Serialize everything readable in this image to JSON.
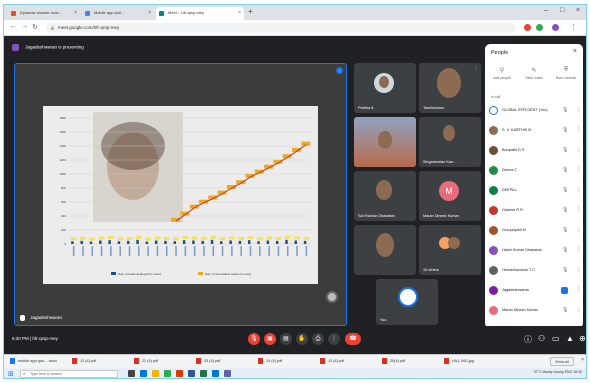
{
  "browser": {
    "tabs": [
      {
        "label": "Dynamic shower rods…",
        "color": "#e44d26"
      },
      {
        "label": "Mobile app poll…",
        "color": "#4285f4"
      },
      {
        "label": "Meet – hfr-qrsp-mey",
        "color": "#00897b"
      }
    ],
    "url": "meet.google.com/hfr-qrsp-mey"
  },
  "meet": {
    "presenting": "Jagadeshwaran is presenting",
    "presenter_name": "Jagadeshwaran",
    "time_code": "6:30 PM | hfr-qrsp-mey",
    "tiles": [
      {
        "name": "Prabha A"
      },
      {
        "name": "Tamilselvam"
      },
      {
        "name": ""
      },
      {
        "name": "Singaravelan Kan…"
      },
      {
        "name": "Sai Eshwar Dhanabal"
      },
      {
        "name": "Maran Dinesh Kumar",
        "letter": "M"
      },
      {
        "name": ""
      },
      {
        "name": "10 others"
      },
      {
        "name": "You"
      }
    ]
  },
  "chart": {
    "ytick_labels": [
      "1800",
      "1600",
      "1400",
      "1200",
      "1000",
      "800",
      "600",
      "400",
      "200",
      "0"
    ],
    "legend": [
      "Sum of funds deployed (in Lacs)",
      "Sum of Cumulative funds (in Lacs)"
    ]
  },
  "chart_data": {
    "type": "bar",
    "ylim": [
      0,
      1800
    ],
    "series": [
      {
        "name": "Sum of funds deployed (in Lacs)",
        "color": "#1f4e9b",
        "values": [
          40,
          45,
          35,
          50,
          55,
          40,
          45,
          60,
          35,
          50,
          45,
          40,
          55,
          50,
          45,
          60,
          40,
          50,
          45,
          55,
          40,
          50,
          45,
          60,
          50,
          45
        ]
      },
      {
        "name": "Sum of Cumulative funds (in Lacs)",
        "color": "#f0a820",
        "values": [
          0,
          0,
          0,
          0,
          0,
          0,
          0,
          0,
          0,
          0,
          0,
          330,
          420,
          520,
          590,
          650,
          720,
          800,
          870,
          960,
          1020,
          1090,
          1160,
          1240,
          1330,
          1420
        ]
      }
    ]
  },
  "people": {
    "title": "People",
    "actions": [
      "Add people",
      "Take notes",
      "Host controls"
    ],
    "in_call_label": "In call",
    "participants": [
      {
        "name": "GLOBAL EFFICIENT (You)",
        "color": "#fff",
        "cam": false
      },
      {
        "name": "S. V. KARTHIK B",
        "color": "#8d6a52",
        "cam": false
      },
      {
        "name": "Boopathi D S",
        "color": "#6b4f3a",
        "cam": false
      },
      {
        "name": "Deena C",
        "color": "#1e8e3e",
        "cam": false
      },
      {
        "name": "DEEPA L",
        "color": "#0b8043",
        "cam": false
      },
      {
        "name": "Ganesh R R",
        "color": "#c0392b",
        "cam": false
      },
      {
        "name": "Gurupriyadi M",
        "color": "#a0522d",
        "cam": false
      },
      {
        "name": "Harini Kumar Dhanabal",
        "color": "#8a4fbf",
        "cam": false
      },
      {
        "name": "Hemachandran T C",
        "color": "#5f6368",
        "cam": false
      },
      {
        "name": "Jagadeshwaran",
        "color": "#7b1fa2",
        "cam": true
      },
      {
        "name": "Maran Dinesh Kumar",
        "color": "#e96a7b",
        "cam": false
      }
    ]
  },
  "downloads": [
    {
      "label": "mobile app quo….docx",
      "kind": "doc"
    },
    {
      "label": "12 (4).pdf",
      "kind": "pdf"
    },
    {
      "label": "22 (4).pdf",
      "kind": "pdf"
    },
    {
      "label": "33 (4).pdf",
      "kind": "pdf"
    },
    {
      "label": "14 (4).pdf",
      "kind": "pdf"
    },
    {
      "label": "12 (4).pdf",
      "kind": "pdf"
    },
    {
      "label": "20(4).pdf",
      "kind": "pdf"
    },
    {
      "label": "HILL ING.jpg",
      "kind": "pdf"
    }
  ],
  "downloads_show_all": "Show all",
  "taskbar": {
    "search_placeholder": "Type here to search",
    "tray": "37°C Mostly cloudy  ENG  18:30"
  }
}
